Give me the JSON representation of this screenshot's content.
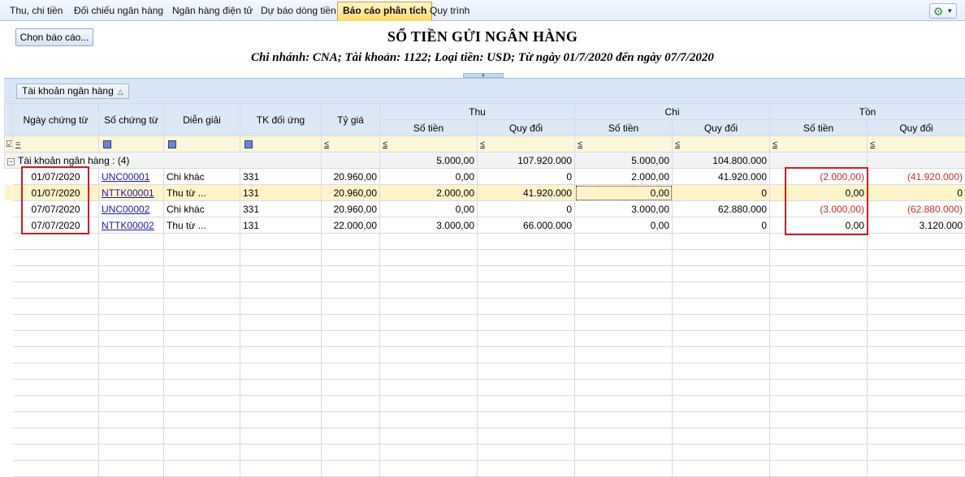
{
  "tabs": [
    {
      "label": "Thu, chi tiền",
      "active": false
    },
    {
      "label": "Đối chiếu ngân hàng",
      "active": false
    },
    {
      "label": "Ngân hàng điện tử",
      "active": false
    },
    {
      "label": "Dự báo dòng tiền",
      "active": false
    },
    {
      "label": "Báo cáo phân tích",
      "active": true
    },
    {
      "label": "Quy trình",
      "active": false
    }
  ],
  "toolbar": {
    "choose_report_label": "Chọn báo cáo...",
    "settings_icon": "gear-icon"
  },
  "report": {
    "title": "SỔ TIỀN GỬI NGÂN HÀNG",
    "subtitle": "Chi nhánh: CNA; Tài khoản: 1122; Loại tiền: USD; Từ ngày 01/7/2020 đến ngày 07/7/2020"
  },
  "group_panel": {
    "chip_label": "Tài khoản ngân hàng"
  },
  "columns": {
    "date": "Ngày chứng từ",
    "doc_no": "Số chứng từ",
    "desc": "Diễn giải",
    "contra": "TK đối ứng",
    "rate": "Tỷ giá",
    "thu": "Thu",
    "chi": "Chi",
    "ton": "Tồn",
    "amount": "Số tiền",
    "converted": "Quy đổi"
  },
  "filter": {
    "eq": "=",
    "le": "≤"
  },
  "group": {
    "label": "Tài khoản ngân hàng : (4)",
    "thu_amount": "5.000,00",
    "thu_converted": "107.920.000",
    "chi_amount": "5.000,00",
    "chi_converted": "104.800.000"
  },
  "rows": [
    {
      "date": "01/07/2020",
      "doc_no": "UNC00001",
      "desc": "Chi khác",
      "contra": "331",
      "rate": "20.960,00",
      "thu_amount": "0,00",
      "thu_converted": "0",
      "chi_amount": "2.000,00",
      "chi_converted": "41.920.000",
      "ton_amount": "(2.000,00)",
      "ton_converted": "(41.920.000)"
    },
    {
      "date": "01/07/2020",
      "doc_no": "NTTK00001",
      "desc": "Thu từ ...",
      "contra": "131",
      "rate": "20.960,00",
      "thu_amount": "2.000,00",
      "thu_converted": "41.920.000",
      "chi_amount": "0,00",
      "chi_converted": "0",
      "ton_amount": "0,00",
      "ton_converted": "0"
    },
    {
      "date": "07/07/2020",
      "doc_no": "UNC00002",
      "desc": "Chi khác",
      "contra": "331",
      "rate": "20.960,00",
      "thu_amount": "0,00",
      "thu_converted": "0",
      "chi_amount": "3.000,00",
      "chi_converted": "62.880.000",
      "ton_amount": "(3.000,00)",
      "ton_converted": "(62.880.000)"
    },
    {
      "date": "07/07/2020",
      "doc_no": "NTTK00002",
      "desc": "Thu từ ...",
      "contra": "131",
      "rate": "22.000,00",
      "thu_amount": "3.000,00",
      "thu_converted": "66.000.000",
      "chi_amount": "0,00",
      "chi_converted": "0",
      "ton_amount": "0,00",
      "ton_converted": "3.120.000"
    }
  ],
  "colors": {
    "accent": "#ffd96a",
    "negative": "#c0302c",
    "highlight": "#cc1f1f",
    "link": "#1a1aa8"
  }
}
